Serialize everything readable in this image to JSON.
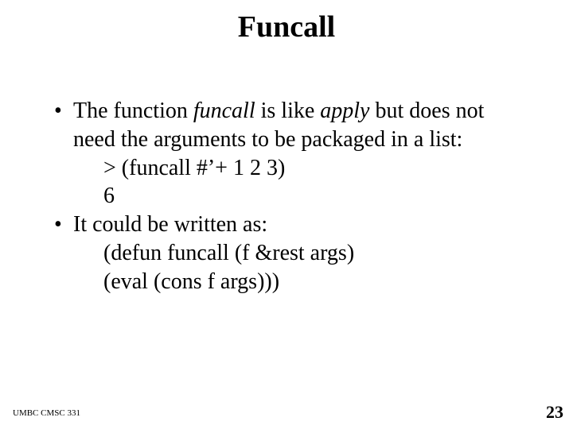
{
  "title": "Funcall",
  "bullet1": {
    "pre": "The function ",
    "funcall": "funcall",
    "mid1": " is like ",
    "apply": "apply",
    "post": " but does not need the arguments to be packaged in a list:"
  },
  "code1_line1": ">  (funcall  #’+  1  2  3)",
  "code1_line2": "6",
  "bullet2": "It could be written as:",
  "code2_line1": "(defun funcall (f &rest args)",
  "code2_line2": " (eval (cons f args)))",
  "footer_left": "UMBC CMSC 331",
  "page_number": "23",
  "bullet_char": "•"
}
